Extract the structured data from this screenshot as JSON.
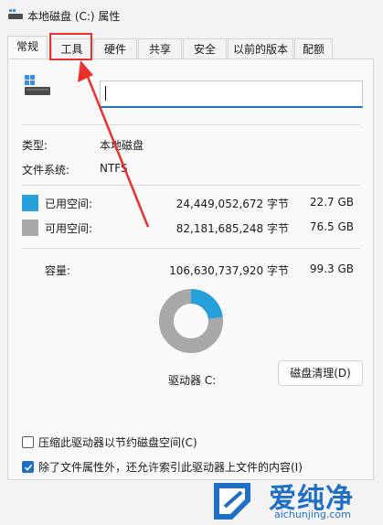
{
  "window": {
    "title": "本地磁盘 (C:) 属性"
  },
  "tabs": [
    {
      "label": "常规",
      "active": true
    },
    {
      "label": "工具",
      "active": false
    },
    {
      "label": "硬件",
      "active": false
    },
    {
      "label": "共享",
      "active": false
    },
    {
      "label": "安全",
      "active": false
    },
    {
      "label": "以前的版本",
      "active": false
    },
    {
      "label": "配额",
      "active": false
    }
  ],
  "general": {
    "name_input_value": "",
    "type_label": "类型:",
    "type_value": "本地磁盘",
    "fs_label": "文件系统:",
    "fs_value": "NTFS"
  },
  "space": {
    "used": {
      "label": "已用空间:",
      "bytes": "24,449,052,672 字节",
      "size": "22.7 GB",
      "color": "#26a0da"
    },
    "free": {
      "label": "可用空间:",
      "bytes": "82,181,685,248 字节",
      "size": "76.5 GB",
      "color": "#a8a8a8"
    },
    "capacity": {
      "label": "容量:",
      "bytes": "106,630,737,920 字节",
      "size": "99.3 GB"
    },
    "used_fraction": 0.229
  },
  "drive_label": "驱动器 C:",
  "cleanup_button": "磁盘清理(D)",
  "options": {
    "compress": {
      "label": "压缩此驱动器以节约磁盘空间(C)",
      "checked": false
    },
    "index": {
      "label": "除了文件属性外，还允许索引此驱动器上文件的内容(I)",
      "checked": true
    }
  },
  "watermark": {
    "text": "爱纯净",
    "url": "aichunjing.com"
  }
}
